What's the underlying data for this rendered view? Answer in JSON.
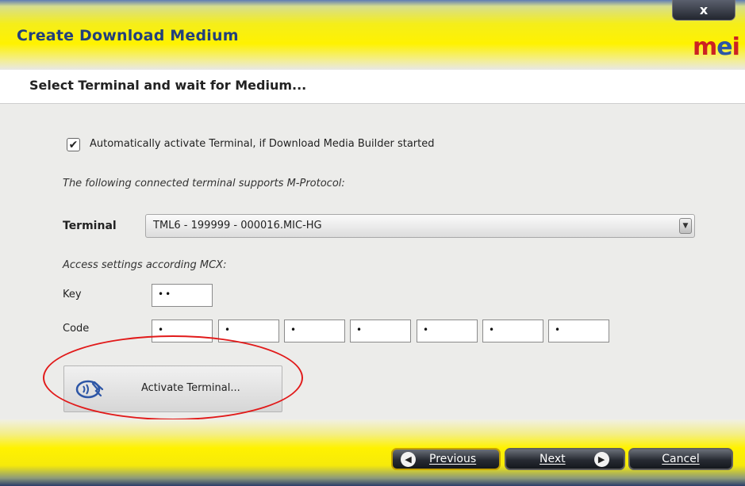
{
  "window": {
    "title": "Create Download Medium",
    "close_label": "x",
    "logo": {
      "part1": "m",
      "part2": "e",
      "part3": "i"
    }
  },
  "subtitle": "Select Terminal and wait for Medium...",
  "auto_activate": {
    "checked": true,
    "label": "Automatically activate Terminal, if Download Media Builder started"
  },
  "note": "The following connected terminal supports M-Protocol:",
  "terminal": {
    "label": "Terminal",
    "selected": "TML6 - 199999 - 000016.MIC-HG"
  },
  "access_note": "Access settings according MCX:",
  "key": {
    "label": "Key",
    "value": "••"
  },
  "code": {
    "label": "Code",
    "values": [
      "•",
      "•",
      "•",
      "•",
      "•",
      "•",
      "•"
    ]
  },
  "activate_button": {
    "label": "Activate Terminal...",
    "icon": "contactless-card-icon"
  },
  "footer": {
    "previous_label": "Previous",
    "next_label": "Next",
    "cancel_label": "Cancel"
  },
  "colors": {
    "title": "#22407c",
    "accent_yellow": "#fff200",
    "highlight_oval": "#e11a1a"
  }
}
